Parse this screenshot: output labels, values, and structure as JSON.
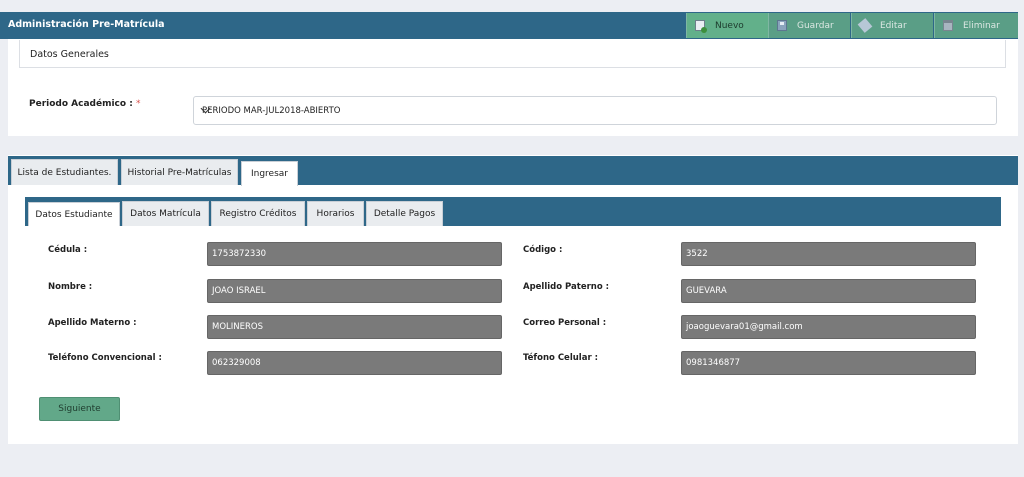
{
  "header": {
    "title": "Administración Pre-Matrícula",
    "buttons": {
      "nuevo": "Nuevo",
      "guardar": "Guardar",
      "editar": "Editar",
      "eliminar": "Eliminar"
    }
  },
  "general": {
    "section_title": "Datos Generales",
    "periodo_label": "Periodo Académico :",
    "required_mark": "*",
    "periodo_value": "PERIODO MAR-JUL2018-ABIERTO"
  },
  "main_tabs": [
    {
      "label": "Lista de Estudiantes."
    },
    {
      "label": "Historial Pre-Matrículas"
    },
    {
      "label": "Ingresar"
    }
  ],
  "sub_tabs": [
    {
      "label": "Datos Estudiante"
    },
    {
      "label": "Datos Matrícula"
    },
    {
      "label": "Registro Créditos"
    },
    {
      "label": "Horarios"
    },
    {
      "label": "Detalle Pagos"
    }
  ],
  "form": {
    "cedula": {
      "label": "Cédula :",
      "value": "1753872330"
    },
    "codigo": {
      "label": "Código :",
      "value": "3522"
    },
    "nombre": {
      "label": "Nombre :",
      "value": "JOAO ISRAEL"
    },
    "apellido_paterno": {
      "label": "Apellido Paterno :",
      "value": "GUEVARA"
    },
    "apellido_materno": {
      "label": "Apellido Materno :",
      "value": "MOLINEROS"
    },
    "correo_personal": {
      "label": "Correo Personal :",
      "value": "joaoguevara01@gmail.com"
    },
    "telefono_convencional": {
      "label": "Teléfono Convencional :",
      "value": "062329008"
    },
    "telefono_celular": {
      "label": "Téfono Celular :",
      "value": "0981346877"
    }
  },
  "actions": {
    "next_label": "Siguiente"
  },
  "colors": {
    "primary": "#2e6788",
    "success": "#62a889",
    "input_bg": "#7a7a7a"
  }
}
